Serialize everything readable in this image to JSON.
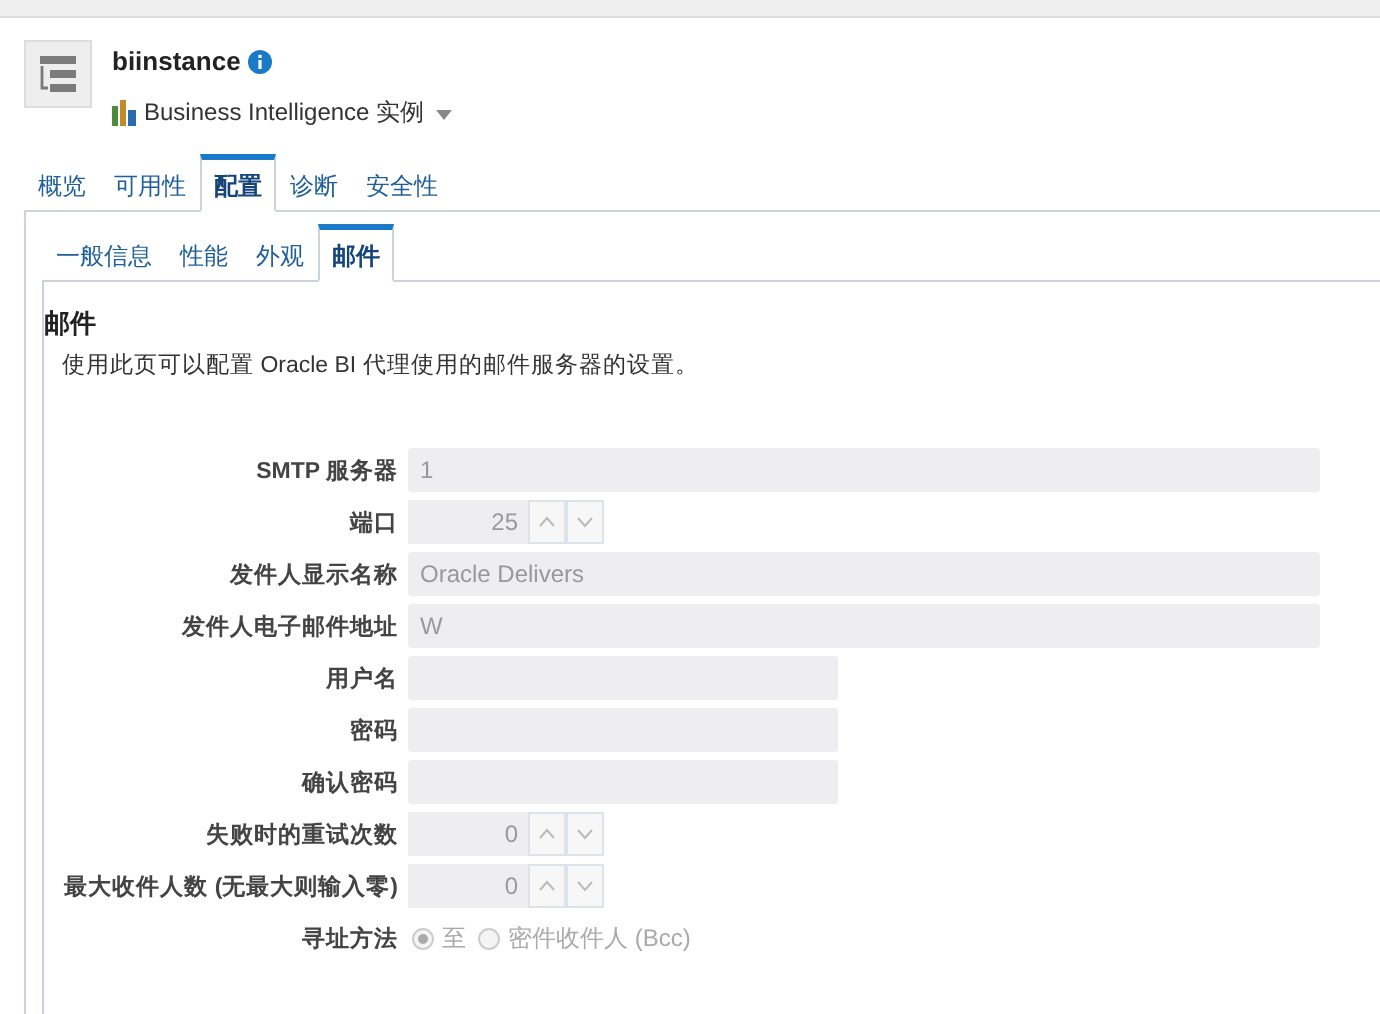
{
  "header": {
    "title": "biinstance",
    "subtitle": "Business Intelligence 实例"
  },
  "tabs": [
    {
      "label": "概览",
      "selected": false
    },
    {
      "label": "可用性",
      "selected": false
    },
    {
      "label": "配置",
      "selected": true
    },
    {
      "label": "诊断",
      "selected": false
    },
    {
      "label": "安全性",
      "selected": false
    }
  ],
  "subtabs": [
    {
      "label": "一般信息",
      "selected": false
    },
    {
      "label": "性能",
      "selected": false
    },
    {
      "label": "外观",
      "selected": false
    },
    {
      "label": "邮件",
      "selected": true
    }
  ],
  "section": {
    "title": "邮件",
    "description": "使用此页可以配置 Oracle BI 代理使用的邮件服务器的设置。"
  },
  "fields": [
    {
      "kind": "text",
      "label": "SMTP 服务器",
      "value": "1",
      "wide": true
    },
    {
      "kind": "spinner",
      "label": "端口",
      "value": "25"
    },
    {
      "kind": "text",
      "label": "发件人显示名称",
      "value": "Oracle Delivers",
      "wide": true
    },
    {
      "kind": "text",
      "label": "发件人电子邮件地址",
      "value": "W",
      "wide": true
    },
    {
      "kind": "text",
      "label": "用户名",
      "wide": false
    },
    {
      "kind": "text",
      "label": "密码",
      "wide": false
    },
    {
      "kind": "text",
      "label": "确认密码",
      "wide": false
    },
    {
      "kind": "spinner",
      "label": "失败时的重试次数",
      "value": "0"
    },
    {
      "kind": "spinner",
      "label": "最大收件人数 (无最大则输入零)",
      "value": "0"
    },
    {
      "kind": "radio",
      "label": "寻址方法",
      "options": [
        {
          "label": "至",
          "selected": true
        },
        {
          "label": "密件收件人 (Bcc)",
          "selected": false
        }
      ]
    }
  ]
}
